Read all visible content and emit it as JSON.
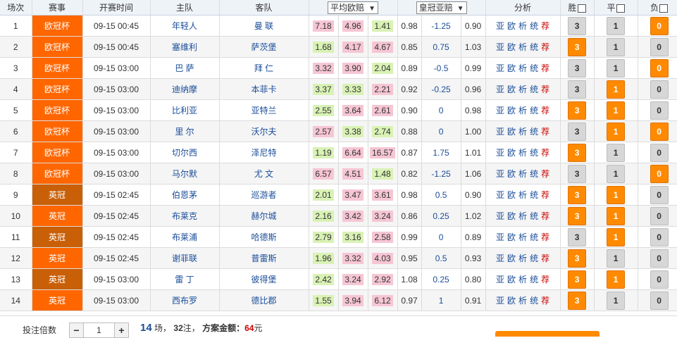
{
  "header": {
    "col_no": "场次",
    "col_league": "赛事",
    "col_time": "开赛时间",
    "col_home": "主队",
    "col_away": "客队",
    "col_odds_select": "平均欧赔",
    "col_asian_select": "皇冠亚赔",
    "col_analysis": "分析",
    "col_win": "胜",
    "col_draw": "平",
    "col_lose": "负"
  },
  "colors": {
    "league_ucl": "#ff6600",
    "league_epl": "#c95f06",
    "accent": "#ff8a00",
    "link": "#1a4d99"
  },
  "analysis_links": [
    "亚",
    "欧",
    "析",
    "统",
    "荐"
  ],
  "rows": [
    {
      "no": "1",
      "league": "欧冠杯",
      "lc": "c1",
      "time": "09-15 00:45",
      "home": "年轻人",
      "away": "曼 联",
      "o1": "7.18",
      "o2": "4.96",
      "o3": "1.41",
      "c1": "hi",
      "c2": "hi",
      "c3": "lo",
      "a1": "0.98",
      "hcp": "-1.25",
      "a2": "0.90",
      "w": "3",
      "d": "1",
      "l": "0",
      "won": false,
      "don": false,
      "lon": true
    },
    {
      "no": "2",
      "league": "欧冠杯",
      "lc": "c1",
      "time": "09-15 00:45",
      "home": "塞维利",
      "away": "萨茨堡",
      "o1": "1.68",
      "o2": "4.17",
      "o3": "4.67",
      "c1": "lo",
      "c2": "hi",
      "c3": "hi",
      "a1": "0.85",
      "hcp": "0.75",
      "a2": "1.03",
      "w": "3",
      "d": "1",
      "l": "0",
      "won": true,
      "don": false,
      "lon": false
    },
    {
      "no": "3",
      "league": "欧冠杯",
      "lc": "c1",
      "time": "09-15 03:00",
      "home": "巴 萨",
      "away": "拜 仁",
      "o1": "3.32",
      "o2": "3.90",
      "o3": "2.04",
      "c1": "hi",
      "c2": "hi",
      "c3": "lo",
      "a1": "0.89",
      "hcp": "-0.5",
      "a2": "0.99",
      "w": "3",
      "d": "1",
      "l": "0",
      "won": false,
      "don": false,
      "lon": true
    },
    {
      "no": "4",
      "league": "欧冠杯",
      "lc": "c1",
      "time": "09-15 03:00",
      "home": "迪纳摩",
      "away": "本菲卡",
      "o1": "3.37",
      "o2": "3.33",
      "o3": "2.21",
      "c1": "lo",
      "c2": "lo",
      "c3": "hi",
      "a1": "0.92",
      "hcp": "-0.25",
      "a2": "0.96",
      "w": "3",
      "d": "1",
      "l": "0",
      "won": false,
      "don": true,
      "lon": false
    },
    {
      "no": "5",
      "league": "欧冠杯",
      "lc": "c1",
      "time": "09-15 03:00",
      "home": "比利亚",
      "away": "亚特兰",
      "o1": "2.55",
      "o2": "3.64",
      "o3": "2.61",
      "c1": "lo",
      "c2": "hi",
      "c3": "hi",
      "a1": "0.90",
      "hcp": "0",
      "a2": "0.98",
      "w": "3",
      "d": "1",
      "l": "0",
      "won": true,
      "don": true,
      "lon": false
    },
    {
      "no": "6",
      "league": "欧冠杯",
      "lc": "c1",
      "time": "09-15 03:00",
      "home": "里 尔",
      "away": "沃尔夫",
      "o1": "2.57",
      "o2": "3.38",
      "o3": "2.74",
      "c1": "hi",
      "c2": "lo",
      "c3": "lo",
      "a1": "0.88",
      "hcp": "0",
      "a2": "1.00",
      "w": "3",
      "d": "1",
      "l": "0",
      "won": false,
      "don": true,
      "lon": true
    },
    {
      "no": "7",
      "league": "欧冠杯",
      "lc": "c1",
      "time": "09-15 03:00",
      "home": "切尔西",
      "away": "泽尼特",
      "o1": "1.19",
      "o2": "6.64",
      "o3": "16.57",
      "c1": "lo",
      "c2": "hi",
      "c3": "hi",
      "a1": "0.87",
      "hcp": "1.75",
      "a2": "1.01",
      "w": "3",
      "d": "1",
      "l": "0",
      "won": true,
      "don": false,
      "lon": false
    },
    {
      "no": "8",
      "league": "欧冠杯",
      "lc": "c1",
      "time": "09-15 03:00",
      "home": "马尔默",
      "away": "尤 文",
      "o1": "6.57",
      "o2": "4.51",
      "o3": "1.48",
      "c1": "hi",
      "c2": "hi",
      "c3": "lo",
      "a1": "0.82",
      "hcp": "-1.25",
      "a2": "1.06",
      "w": "3",
      "d": "1",
      "l": "0",
      "won": false,
      "don": false,
      "lon": true
    },
    {
      "no": "9",
      "league": "英冠",
      "lc": "c2",
      "time": "09-15 02:45",
      "home": "伯恩茅",
      "away": "巡游者",
      "o1": "2.01",
      "o2": "3.47",
      "o3": "3.61",
      "c1": "lo",
      "c2": "hi",
      "c3": "hi",
      "a1": "0.98",
      "hcp": "0.5",
      "a2": "0.90",
      "w": "3",
      "d": "1",
      "l": "0",
      "won": true,
      "don": true,
      "lon": false
    },
    {
      "no": "10",
      "league": "英冠",
      "lc": "c2",
      "time": "09-15 02:45",
      "home": "布莱克",
      "away": "赫尔城",
      "o1": "2.16",
      "o2": "3.42",
      "o3": "3.24",
      "c1": "lo",
      "c2": "hi",
      "c3": "hi",
      "a1": "0.86",
      "hcp": "0.25",
      "a2": "1.02",
      "w": "3",
      "d": "1",
      "l": "0",
      "won": true,
      "don": true,
      "lon": false
    },
    {
      "no": "11",
      "league": "英冠",
      "lc": "c2",
      "time": "09-15 02:45",
      "home": "布莱浦",
      "away": "哈德斯",
      "o1": "2.79",
      "o2": "3.16",
      "o3": "2.58",
      "c1": "lo",
      "c2": "lo",
      "c3": "hi",
      "a1": "0.99",
      "hcp": "0",
      "a2": "0.89",
      "w": "3",
      "d": "1",
      "l": "0",
      "won": false,
      "don": true,
      "lon": false
    },
    {
      "no": "12",
      "league": "英冠",
      "lc": "c2",
      "time": "09-15 02:45",
      "home": "谢菲联",
      "away": "普雷斯",
      "o1": "1.96",
      "o2": "3.32",
      "o3": "4.03",
      "c1": "lo",
      "c2": "hi",
      "c3": "hi",
      "a1": "0.95",
      "hcp": "0.5",
      "a2": "0.93",
      "w": "3",
      "d": "1",
      "l": "0",
      "won": true,
      "don": false,
      "lon": false
    },
    {
      "no": "13",
      "league": "英冠",
      "lc": "c2",
      "time": "09-15 03:00",
      "home": "雷 丁",
      "away": "彼得堡",
      "o1": "2.42",
      "o2": "3.24",
      "o3": "2.92",
      "c1": "lo",
      "c2": "hi",
      "c3": "hi",
      "a1": "1.08",
      "hcp": "0.25",
      "a2": "0.80",
      "w": "3",
      "d": "1",
      "l": "0",
      "won": true,
      "don": true,
      "lon": false
    },
    {
      "no": "14",
      "league": "英冠",
      "lc": "c2",
      "time": "09-15 03:00",
      "home": "西布罗",
      "away": "德比郡",
      "o1": "1.55",
      "o2": "3.94",
      "o3": "6.12",
      "c1": "lo",
      "c2": "hi",
      "c3": "hi",
      "a1": "0.97",
      "hcp": "1",
      "a2": "0.91",
      "w": "3",
      "d": "1",
      "l": "0",
      "won": true,
      "don": false,
      "lon": false
    }
  ],
  "footer": {
    "multiplier_label": "投注倍数",
    "minus": "−",
    "multiplier_value": "1",
    "plus": "+",
    "match_count": "14",
    "match_unit": "场，",
    "bet_count": "32",
    "bet_unit": "注，",
    "amount_label": "方案金额：",
    "amount": "64",
    "amount_unit": "元"
  }
}
